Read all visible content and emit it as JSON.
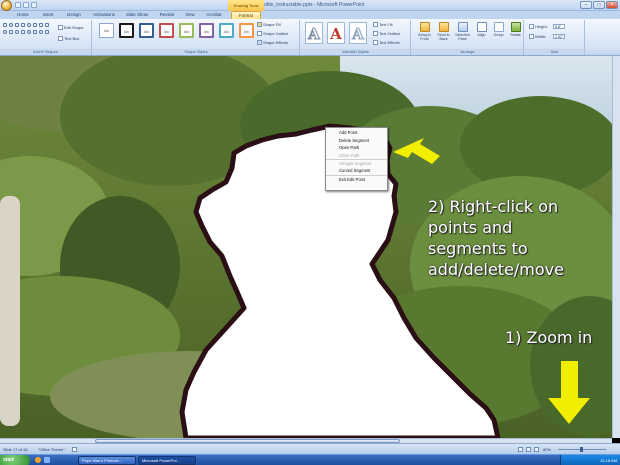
{
  "window": {
    "title": "invisible_instructable.pptx - Microsoft PowerPoint",
    "contextual_tab": "Drawing Tools",
    "minimize": "–",
    "maximize": "□",
    "close": "×"
  },
  "tabs": [
    "Home",
    "Insert",
    "Design",
    "Animations",
    "Slide Show",
    "Review",
    "View",
    "Acrobat",
    "Format"
  ],
  "active_tab": "Format",
  "ribbon": {
    "insert_shapes": {
      "label": "Insert Shapes",
      "edit_shape": "Edit Shape",
      "text_box": "Text Box"
    },
    "shape_styles": {
      "label": "Shape Styles",
      "style_sample": "Abc",
      "fill": "Shape Fill",
      "outline": "Shape Outline",
      "effects": "Shape Effects"
    },
    "wordart_styles": {
      "label": "WordArt Styles",
      "glyph": "A",
      "fill": "Text Fill",
      "outline": "Text Outline",
      "effects": "Text Effects"
    },
    "arrange": {
      "label": "Arrange",
      "bring_front": "Bring to Front",
      "send_back": "Send to Back",
      "selection_pane": "Selection Pane",
      "align": "Align",
      "group": "Group",
      "rotate": "Rotate"
    },
    "size": {
      "label": "Size",
      "height_label": "Height:",
      "height_value": "6.8\"",
      "width_label": "Width:",
      "width_value": "2.82\""
    }
  },
  "context_menu": {
    "items": [
      {
        "label": "Add Point",
        "enabled": true
      },
      {
        "label": "Delete Segment",
        "enabled": true
      },
      {
        "label": "Open Path",
        "enabled": true
      },
      {
        "label": "Close Path",
        "enabled": false
      },
      {
        "label": "Straight Segment",
        "enabled": false
      },
      {
        "label": "Curved Segment",
        "enabled": true
      },
      {
        "label": "Exit Edit Point",
        "enabled": true
      }
    ]
  },
  "annotations": {
    "right_click_lines": [
      "2) Right-click on",
      "points and",
      "segments to",
      "add/delete/move"
    ],
    "zoom_in": "1) Zoom in",
    "arrow_color": "#f2ee00"
  },
  "statusbar": {
    "slide_info": "Slide 17 of 18",
    "theme": "\"Office Theme\"",
    "zoom": "80%"
  },
  "taskbar": {
    "start_label": "start",
    "buttons": [
      "Pope Man's Photosh...",
      "Microsoft PowerPoi..."
    ],
    "clock": "11:18 AM"
  },
  "colors": {
    "ribbon_blue": "#d6e4f6",
    "format_tab": "#ffe08a",
    "shape_fill": "#ffffff",
    "shape_outline": "#2a0f14"
  }
}
